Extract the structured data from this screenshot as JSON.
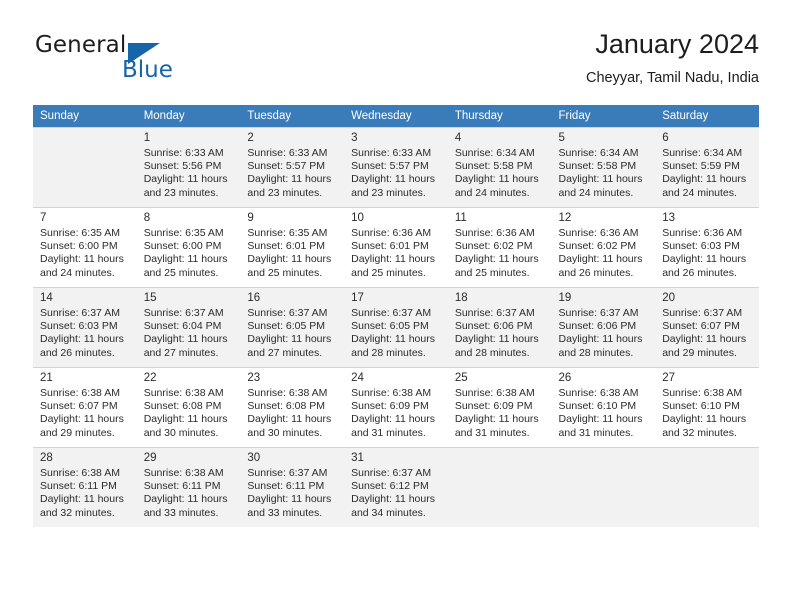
{
  "brand": {
    "name_part1": "General",
    "name_part2": "Blue",
    "triangle_icon": "triangle-icon",
    "accent_color": "#1565a8"
  },
  "header": {
    "title": "January 2024",
    "subtitle": "Cheyyar, Tamil Nadu, India"
  },
  "theme": {
    "header_row_color": "#3a7cba",
    "shaded_row_color": "#f2f2f2",
    "grid_line_color": "#d4d4d4"
  },
  "calendar": {
    "weekday_headers": [
      "Sunday",
      "Monday",
      "Tuesday",
      "Wednesday",
      "Thursday",
      "Friday",
      "Saturday"
    ],
    "weeks": [
      [
        {
          "day": "",
          "sunrise": "",
          "sunset": "",
          "daylight1": "",
          "daylight2": ""
        },
        {
          "day": "1",
          "sunrise": "Sunrise: 6:33 AM",
          "sunset": "Sunset: 5:56 PM",
          "daylight1": "Daylight: 11 hours",
          "daylight2": "and 23 minutes."
        },
        {
          "day": "2",
          "sunrise": "Sunrise: 6:33 AM",
          "sunset": "Sunset: 5:57 PM",
          "daylight1": "Daylight: 11 hours",
          "daylight2": "and 23 minutes."
        },
        {
          "day": "3",
          "sunrise": "Sunrise: 6:33 AM",
          "sunset": "Sunset: 5:57 PM",
          "daylight1": "Daylight: 11 hours",
          "daylight2": "and 23 minutes."
        },
        {
          "day": "4",
          "sunrise": "Sunrise: 6:34 AM",
          "sunset": "Sunset: 5:58 PM",
          "daylight1": "Daylight: 11 hours",
          "daylight2": "and 24 minutes."
        },
        {
          "day": "5",
          "sunrise": "Sunrise: 6:34 AM",
          "sunset": "Sunset: 5:58 PM",
          "daylight1": "Daylight: 11 hours",
          "daylight2": "and 24 minutes."
        },
        {
          "day": "6",
          "sunrise": "Sunrise: 6:34 AM",
          "sunset": "Sunset: 5:59 PM",
          "daylight1": "Daylight: 11 hours",
          "daylight2": "and 24 minutes."
        }
      ],
      [
        {
          "day": "7",
          "sunrise": "Sunrise: 6:35 AM",
          "sunset": "Sunset: 6:00 PM",
          "daylight1": "Daylight: 11 hours",
          "daylight2": "and 24 minutes."
        },
        {
          "day": "8",
          "sunrise": "Sunrise: 6:35 AM",
          "sunset": "Sunset: 6:00 PM",
          "daylight1": "Daylight: 11 hours",
          "daylight2": "and 25 minutes."
        },
        {
          "day": "9",
          "sunrise": "Sunrise: 6:35 AM",
          "sunset": "Sunset: 6:01 PM",
          "daylight1": "Daylight: 11 hours",
          "daylight2": "and 25 minutes."
        },
        {
          "day": "10",
          "sunrise": "Sunrise: 6:36 AM",
          "sunset": "Sunset: 6:01 PM",
          "daylight1": "Daylight: 11 hours",
          "daylight2": "and 25 minutes."
        },
        {
          "day": "11",
          "sunrise": "Sunrise: 6:36 AM",
          "sunset": "Sunset: 6:02 PM",
          "daylight1": "Daylight: 11 hours",
          "daylight2": "and 25 minutes."
        },
        {
          "day": "12",
          "sunrise": "Sunrise: 6:36 AM",
          "sunset": "Sunset: 6:02 PM",
          "daylight1": "Daylight: 11 hours",
          "daylight2": "and 26 minutes."
        },
        {
          "day": "13",
          "sunrise": "Sunrise: 6:36 AM",
          "sunset": "Sunset: 6:03 PM",
          "daylight1": "Daylight: 11 hours",
          "daylight2": "and 26 minutes."
        }
      ],
      [
        {
          "day": "14",
          "sunrise": "Sunrise: 6:37 AM",
          "sunset": "Sunset: 6:03 PM",
          "daylight1": "Daylight: 11 hours",
          "daylight2": "and 26 minutes."
        },
        {
          "day": "15",
          "sunrise": "Sunrise: 6:37 AM",
          "sunset": "Sunset: 6:04 PM",
          "daylight1": "Daylight: 11 hours",
          "daylight2": "and 27 minutes."
        },
        {
          "day": "16",
          "sunrise": "Sunrise: 6:37 AM",
          "sunset": "Sunset: 6:05 PM",
          "daylight1": "Daylight: 11 hours",
          "daylight2": "and 27 minutes."
        },
        {
          "day": "17",
          "sunrise": "Sunrise: 6:37 AM",
          "sunset": "Sunset: 6:05 PM",
          "daylight1": "Daylight: 11 hours",
          "daylight2": "and 28 minutes."
        },
        {
          "day": "18",
          "sunrise": "Sunrise: 6:37 AM",
          "sunset": "Sunset: 6:06 PM",
          "daylight1": "Daylight: 11 hours",
          "daylight2": "and 28 minutes."
        },
        {
          "day": "19",
          "sunrise": "Sunrise: 6:37 AM",
          "sunset": "Sunset: 6:06 PM",
          "daylight1": "Daylight: 11 hours",
          "daylight2": "and 28 minutes."
        },
        {
          "day": "20",
          "sunrise": "Sunrise: 6:37 AM",
          "sunset": "Sunset: 6:07 PM",
          "daylight1": "Daylight: 11 hours",
          "daylight2": "and 29 minutes."
        }
      ],
      [
        {
          "day": "21",
          "sunrise": "Sunrise: 6:38 AM",
          "sunset": "Sunset: 6:07 PM",
          "daylight1": "Daylight: 11 hours",
          "daylight2": "and 29 minutes."
        },
        {
          "day": "22",
          "sunrise": "Sunrise: 6:38 AM",
          "sunset": "Sunset: 6:08 PM",
          "daylight1": "Daylight: 11 hours",
          "daylight2": "and 30 minutes."
        },
        {
          "day": "23",
          "sunrise": "Sunrise: 6:38 AM",
          "sunset": "Sunset: 6:08 PM",
          "daylight1": "Daylight: 11 hours",
          "daylight2": "and 30 minutes."
        },
        {
          "day": "24",
          "sunrise": "Sunrise: 6:38 AM",
          "sunset": "Sunset: 6:09 PM",
          "daylight1": "Daylight: 11 hours",
          "daylight2": "and 31 minutes."
        },
        {
          "day": "25",
          "sunrise": "Sunrise: 6:38 AM",
          "sunset": "Sunset: 6:09 PM",
          "daylight1": "Daylight: 11 hours",
          "daylight2": "and 31 minutes."
        },
        {
          "day": "26",
          "sunrise": "Sunrise: 6:38 AM",
          "sunset": "Sunset: 6:10 PM",
          "daylight1": "Daylight: 11 hours",
          "daylight2": "and 31 minutes."
        },
        {
          "day": "27",
          "sunrise": "Sunrise: 6:38 AM",
          "sunset": "Sunset: 6:10 PM",
          "daylight1": "Daylight: 11 hours",
          "daylight2": "and 32 minutes."
        }
      ],
      [
        {
          "day": "28",
          "sunrise": "Sunrise: 6:38 AM",
          "sunset": "Sunset: 6:11 PM",
          "daylight1": "Daylight: 11 hours",
          "daylight2": "and 32 minutes."
        },
        {
          "day": "29",
          "sunrise": "Sunrise: 6:38 AM",
          "sunset": "Sunset: 6:11 PM",
          "daylight1": "Daylight: 11 hours",
          "daylight2": "and 33 minutes."
        },
        {
          "day": "30",
          "sunrise": "Sunrise: 6:37 AM",
          "sunset": "Sunset: 6:11 PM",
          "daylight1": "Daylight: 11 hours",
          "daylight2": "and 33 minutes."
        },
        {
          "day": "31",
          "sunrise": "Sunrise: 6:37 AM",
          "sunset": "Sunset: 6:12 PM",
          "daylight1": "Daylight: 11 hours",
          "daylight2": "and 34 minutes."
        },
        {
          "day": "",
          "sunrise": "",
          "sunset": "",
          "daylight1": "",
          "daylight2": ""
        },
        {
          "day": "",
          "sunrise": "",
          "sunset": "",
          "daylight1": "",
          "daylight2": ""
        },
        {
          "day": "",
          "sunrise": "",
          "sunset": "",
          "daylight1": "",
          "daylight2": ""
        }
      ]
    ]
  }
}
